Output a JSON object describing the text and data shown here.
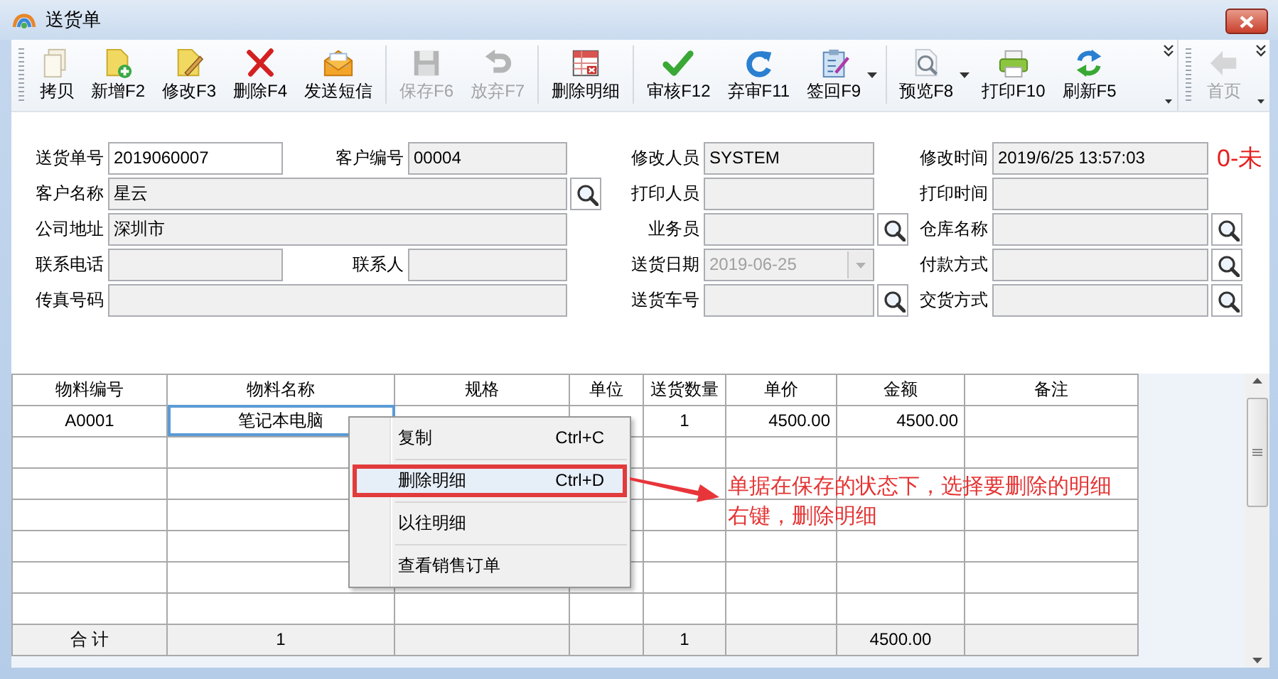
{
  "window": {
    "title": "送货单"
  },
  "toolbar": [
    {
      "items": [
        {
          "kind": "button",
          "label": "拷贝",
          "disabled": false
        },
        {
          "kind": "button",
          "label": "新增F2",
          "disabled": false
        },
        {
          "kind": "button",
          "label": "修改F3",
          "disabled": false
        },
        {
          "kind": "button",
          "label": "删除F4",
          "disabled": false
        },
        {
          "kind": "button",
          "label": "发送短信",
          "disabled": false
        },
        {
          "kind": "separator"
        },
        {
          "kind": "button",
          "label": "保存F6",
          "disabled": true
        },
        {
          "kind": "button",
          "label": "放弃F7",
          "disabled": true
        },
        {
          "kind": "separator"
        },
        {
          "kind": "button",
          "label": "删除明细",
          "disabled": false
        },
        {
          "kind": "separator"
        },
        {
          "kind": "button",
          "label": "审核F12",
          "disabled": false
        },
        {
          "kind": "button",
          "label": "弃审F11",
          "disabled": false
        },
        {
          "kind": "menu-button",
          "label": "签回F9",
          "disabled": false
        },
        {
          "kind": "separator"
        },
        {
          "kind": "menu-button",
          "label": "预览F8",
          "disabled": false
        },
        {
          "kind": "button",
          "label": "打印F10",
          "disabled": false
        },
        {
          "kind": "button",
          "label": "刷新F5",
          "disabled": false
        },
        {
          "kind": "overflow"
        }
      ]
    },
    {
      "items": [
        {
          "kind": "button",
          "label": "首页",
          "disabled": true
        },
        {
          "kind": "overflow"
        }
      ]
    }
  ],
  "form": {
    "left_rows": [
      [
        {
          "label": "送货单号",
          "value": "2019060007",
          "kind": "short",
          "editable": true
        },
        {
          "label": "客户编号",
          "value": "00004",
          "kind": "short",
          "editable": false
        }
      ],
      [
        {
          "label": "客户名称",
          "value": "星云",
          "kind": "wide-lookup",
          "editable": false
        }
      ],
      [
        {
          "label": "公司地址",
          "value": "深圳市",
          "kind": "wide",
          "editable": false
        }
      ],
      [
        {
          "label": "联系电话",
          "kind": "short",
          "editable": false
        },
        {
          "label": "联系人",
          "kind": "short",
          "editable": false
        }
      ],
      [
        {
          "label": "传真号码",
          "kind": "wide",
          "editable": false
        }
      ]
    ],
    "right_rows": [
      [
        {
          "label": "修改人员",
          "value": "SYSTEM",
          "kind": "short",
          "editable": false
        },
        {
          "label": "修改时间",
          "value": "2019/6/25 13:57:03",
          "kind": "short",
          "editable": false
        }
      ],
      [
        {
          "label": "打印人员",
          "kind": "short",
          "editable": false
        },
        {
          "label": "打印时间",
          "kind": "short",
          "editable": false
        }
      ],
      [
        {
          "label": "业务员",
          "kind": "lookup",
          "editable": false
        },
        {
          "label": "仓库名称",
          "kind": "lookup",
          "editable": false
        }
      ],
      [
        {
          "label": "送货日期",
          "value": "2019-06-25",
          "kind": "date",
          "editable": false,
          "disabled": true
        },
        {
          "label": "付款方式",
          "kind": "lookup",
          "editable": false
        }
      ],
      [
        {
          "label": "送货车号",
          "kind": "lookup",
          "editable": false
        },
        {
          "label": "交货方式",
          "kind": "lookup",
          "editable": false
        }
      ]
    ],
    "status": "0-未"
  },
  "grid": {
    "columns": [
      "物料编号",
      "物料名称",
      "规格",
      "单位",
      "送货数量",
      "单价",
      "金额",
      "备注"
    ],
    "rows": [
      {
        "code": {
          "text": "A0001",
          "selected": false
        },
        "name": {
          "text": "笔记本电脑",
          "selected": true
        },
        "quantity": {
          "text": "1",
          "selected": false
        },
        "price": {
          "text": "4500.00",
          "selected": false
        },
        "amount": {
          "text": "4500.00",
          "selected": false
        }
      }
    ],
    "footer": {
      "label": "合 计",
      "count": "1",
      "quantity": "1",
      "amount": "4500.00"
    }
  },
  "context_menu": [
    {
      "label": "复制",
      "shortcut": "Ctrl+C",
      "selected": false
    },
    {
      "label": "删除明细",
      "shortcut": "Ctrl+D",
      "selected": true
    },
    {
      "label": "以往明细",
      "selected": false
    },
    {
      "label": "查看销售订单",
      "selected": false
    }
  ],
  "annotation": {
    "lines": [
      "单据在保存的状态下，选择要删除的明细",
      "右键，删除明细"
    ]
  }
}
